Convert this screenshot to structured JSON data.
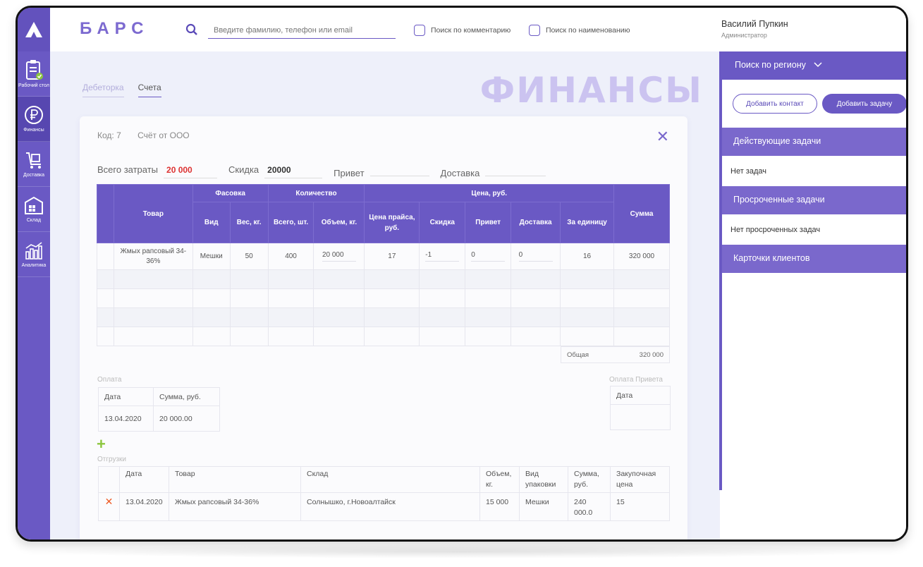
{
  "header": {
    "brand": "БАРС",
    "search_placeholder": "Введите фамилию, телефон или email",
    "check_comment": "Поиск по комментарию",
    "check_name": "Поиск по наименованию"
  },
  "user": {
    "name": "Василий Пупкин",
    "role": "Администратор"
  },
  "sidebar": {
    "items": [
      {
        "label": "Рабочий стол",
        "icon": "clipboard-check-icon"
      },
      {
        "label": "Финансы",
        "icon": "ruble-icon"
      },
      {
        "label": "Доставка",
        "icon": "cart-icon"
      },
      {
        "label": "Склад",
        "icon": "warehouse-icon"
      },
      {
        "label": "Аналитика",
        "icon": "chart-icon"
      }
    ]
  },
  "page": {
    "title": "ФИНАНСЫ",
    "tabs": [
      "Дебеторка",
      "Счета"
    ]
  },
  "invoice": {
    "code": "Код: 7",
    "name": "Счёт от ООО",
    "total_costs_label": "Всего затраты",
    "total_costs_value": "20 000",
    "discount_label": "Скидка",
    "discount_value": "20000",
    "bonus_label": "Привет",
    "bonus_value": "",
    "delivery_label": "Доставка",
    "delivery_value": ""
  },
  "goods_table": {
    "headers": {
      "product": "Товар",
      "packaging": "Фасовка",
      "quantity": "Количество",
      "price": "Цена, руб.",
      "sum": "Сумма",
      "type": "Вид",
      "weight": "Вес, кг.",
      "total_pcs": "Всего, шт.",
      "volume": "Объем, кг.",
      "list_price": "Цена прайса, руб.",
      "discount": "Скидка",
      "bonus": "Привет",
      "delivery": "Доставка",
      "per_unit": "За единицу"
    },
    "row": {
      "product": "Жмых рапсовый 34-36%",
      "type": "Мешки",
      "weight": "50",
      "total_pcs": "400",
      "volume": "20 000",
      "list_price": "17",
      "discount": "-1",
      "bonus": "0",
      "delivery": "0",
      "per_unit": "16",
      "sum": "320 000"
    },
    "total_label": "Общая",
    "total_value": "320 000"
  },
  "payments": {
    "title": "Оплата",
    "col_date": "Дата",
    "col_sum": "Сумма, руб.",
    "row_date": "13.04.2020",
    "row_sum": "20 000.00"
  },
  "bonus_payments": {
    "title": "Оплата Привета",
    "col_date": "Дата"
  },
  "shipments": {
    "title": "Отгрузки",
    "cols": [
      "Дата",
      "Товар",
      "Склад",
      "Объем, кг.",
      "Вид упаковки",
      "Сумма, руб.",
      "Закупочная цена"
    ],
    "row": [
      "13.04.2020",
      "Жмых рапсовый 34-36%",
      "Солнышко, г.Новоалтайск",
      "15 000",
      "Мешки",
      "240 000.0",
      "15"
    ]
  },
  "right_panel": {
    "region": "Поиск по региону",
    "add_contact": "Добавить контакт",
    "add_task": "Добавить задачу",
    "active_tasks": "Действующие задачи",
    "no_tasks": "Нет задач",
    "overdue": "Просроченные задачи",
    "no_overdue": "Нет просроченных задач",
    "client_cards": "Карточки клиентов"
  },
  "colors": {
    "accent": "#6a59c4",
    "brand": "#7c6ad0",
    "alert": "#d33333",
    "add": "#8cc63f",
    "delete": "#ee5a24"
  }
}
